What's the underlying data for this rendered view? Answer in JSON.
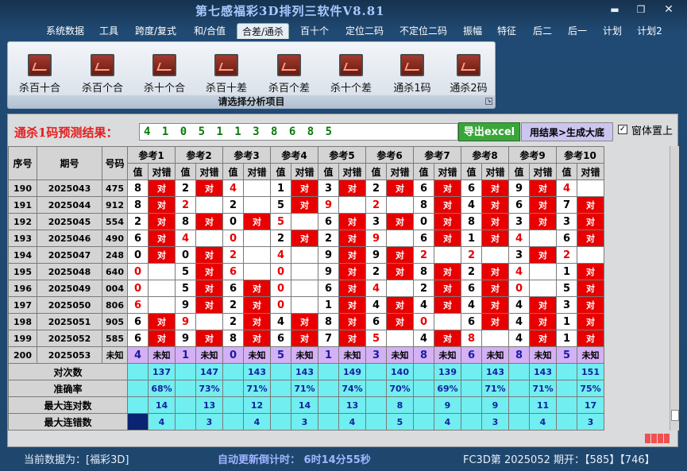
{
  "window": {
    "title": "第七感福彩3D排列三软件V8.81"
  },
  "menu": [
    "系统数据",
    "工具",
    "跨度/复式",
    "和/合值",
    "合差/通杀",
    "百十个",
    "定位二码",
    "不定位二码",
    "振幅",
    "特征",
    "后二",
    "后一",
    "计划",
    "计划2"
  ],
  "ribbon": {
    "buttons": [
      "杀百十合",
      "杀百个合",
      "杀十个合",
      "杀百十差",
      "杀百个差",
      "杀十个差",
      "通杀1码",
      "通杀2码"
    ],
    "caption": "请选择分析项目"
  },
  "prediction": {
    "label": "通杀1码预测结果：",
    "value": "4 1 0 5 1 1 3 8 6 8 5"
  },
  "buttons": {
    "export": "导出excel",
    "generate": "用结果>生成大底",
    "topmost": "窗体置上"
  },
  "table": {
    "headers": {
      "seq": "序号",
      "period": "期号",
      "code": "号码",
      "refs": [
        "参考1",
        "参考2",
        "参考3",
        "参考4",
        "参考5",
        "参考6",
        "参考7",
        "参考8",
        "参考9",
        "参考10"
      ],
      "val": "值",
      "ok": "对错"
    },
    "rows": [
      {
        "seq": "190",
        "period": "2025043",
        "code": "475",
        "cells": [
          [
            "8",
            1,
            0
          ],
          [
            "2",
            1,
            0
          ],
          [
            "4",
            0,
            1
          ],
          [
            "1",
            1,
            0
          ],
          [
            "3",
            1,
            0
          ],
          [
            "2",
            1,
            0
          ],
          [
            "6",
            1,
            0
          ],
          [
            "6",
            1,
            0
          ],
          [
            "9",
            1,
            0
          ],
          [
            "4",
            0,
            1
          ]
        ]
      },
      {
        "seq": "191",
        "period": "2025044",
        "code": "912",
        "cells": [
          [
            "8",
            1,
            0
          ],
          [
            "2",
            0,
            1
          ],
          [
            "2",
            0,
            0
          ],
          [
            "5",
            1,
            0
          ],
          [
            "9",
            0,
            1
          ],
          [
            "2",
            0,
            1
          ],
          [
            "8",
            1,
            0
          ],
          [
            "4",
            1,
            0
          ],
          [
            "6",
            1,
            0
          ],
          [
            "7",
            1,
            0
          ]
        ]
      },
      {
        "seq": "192",
        "period": "2025045",
        "code": "554",
        "cells": [
          [
            "2",
            1,
            0
          ],
          [
            "8",
            1,
            0
          ],
          [
            "0",
            1,
            0
          ],
          [
            "5",
            0,
            1
          ],
          [
            "6",
            1,
            0
          ],
          [
            "3",
            1,
            0
          ],
          [
            "0",
            1,
            0
          ],
          [
            "8",
            1,
            0
          ],
          [
            "3",
            1,
            0
          ],
          [
            "3",
            1,
            0
          ]
        ]
      },
      {
        "seq": "193",
        "period": "2025046",
        "code": "490",
        "cells": [
          [
            "6",
            1,
            0
          ],
          [
            "4",
            0,
            1
          ],
          [
            "0",
            0,
            1
          ],
          [
            "2",
            1,
            0
          ],
          [
            "2",
            1,
            0
          ],
          [
            "9",
            0,
            1
          ],
          [
            "6",
            1,
            0
          ],
          [
            "1",
            1,
            0
          ],
          [
            "4",
            0,
            1
          ],
          [
            "6",
            1,
            0
          ]
        ]
      },
      {
        "seq": "194",
        "period": "2025047",
        "code": "248",
        "cells": [
          [
            "0",
            1,
            0
          ],
          [
            "0",
            1,
            0
          ],
          [
            "2",
            0,
            1
          ],
          [
            "4",
            0,
            1
          ],
          [
            "9",
            1,
            0
          ],
          [
            "9",
            1,
            0
          ],
          [
            "2",
            0,
            1
          ],
          [
            "2",
            0,
            1
          ],
          [
            "3",
            1,
            0
          ],
          [
            "2",
            0,
            1
          ]
        ]
      },
      {
        "seq": "195",
        "period": "2025048",
        "code": "640",
        "cells": [
          [
            "0",
            0,
            1
          ],
          [
            "5",
            1,
            0
          ],
          [
            "6",
            0,
            1
          ],
          [
            "0",
            0,
            1
          ],
          [
            "9",
            1,
            0
          ],
          [
            "2",
            1,
            0
          ],
          [
            "8",
            1,
            0
          ],
          [
            "2",
            1,
            0
          ],
          [
            "4",
            0,
            1
          ],
          [
            "1",
            1,
            0
          ]
        ]
      },
      {
        "seq": "196",
        "period": "2025049",
        "code": "004",
        "cells": [
          [
            "0",
            0,
            1
          ],
          [
            "5",
            1,
            0
          ],
          [
            "6",
            1,
            0
          ],
          [
            "0",
            0,
            1
          ],
          [
            "6",
            1,
            0
          ],
          [
            "4",
            0,
            1
          ],
          [
            "2",
            1,
            0
          ],
          [
            "6",
            1,
            0
          ],
          [
            "0",
            0,
            1
          ],
          [
            "5",
            1,
            0
          ]
        ]
      },
      {
        "seq": "197",
        "period": "2025050",
        "code": "806",
        "cells": [
          [
            "6",
            0,
            1
          ],
          [
            "9",
            1,
            0
          ],
          [
            "2",
            1,
            0
          ],
          [
            "0",
            0,
            1
          ],
          [
            "1",
            1,
            0
          ],
          [
            "4",
            1,
            0
          ],
          [
            "4",
            1,
            0
          ],
          [
            "4",
            1,
            0
          ],
          [
            "4",
            1,
            0
          ],
          [
            "3",
            1,
            0
          ]
        ]
      },
      {
        "seq": "198",
        "period": "2025051",
        "code": "905",
        "cells": [
          [
            "6",
            1,
            0
          ],
          [
            "9",
            0,
            1
          ],
          [
            "2",
            1,
            0
          ],
          [
            "4",
            1,
            0
          ],
          [
            "8",
            1,
            0
          ],
          [
            "6",
            1,
            0
          ],
          [
            "0",
            0,
            1
          ],
          [
            "6",
            1,
            0
          ],
          [
            "4",
            1,
            0
          ],
          [
            "1",
            1,
            0
          ]
        ]
      },
      {
        "seq": "199",
        "period": "2025052",
        "code": "585",
        "cells": [
          [
            "6",
            1,
            0
          ],
          [
            "9",
            1,
            0
          ],
          [
            "8",
            1,
            0
          ],
          [
            "6",
            1,
            0
          ],
          [
            "7",
            1,
            0
          ],
          [
            "5",
            0,
            1
          ],
          [
            "4",
            1,
            0
          ],
          [
            "8",
            0,
            1
          ],
          [
            "4",
            1,
            0
          ],
          [
            "1",
            1,
            0
          ]
        ]
      }
    ],
    "pending": {
      "seq": "200",
      "period": "2025053",
      "code": "未知",
      "vals": [
        "4",
        "1",
        "0",
        "5",
        "1",
        "3",
        "8",
        "6",
        "8",
        "5"
      ],
      "unknown": "未知"
    },
    "stats": [
      {
        "label": "对次数",
        "vals": [
          "137",
          "147",
          "143",
          "143",
          "149",
          "140",
          "139",
          "143",
          "143",
          "151"
        ]
      },
      {
        "label": "准确率",
        "vals": [
          "68%",
          "73%",
          "71%",
          "71%",
          "74%",
          "70%",
          "69%",
          "71%",
          "71%",
          "75%"
        ]
      },
      {
        "label": "最大连对数",
        "vals": [
          "14",
          "13",
          "12",
          "14",
          "13",
          "8",
          "9",
          "9",
          "11",
          "17"
        ]
      },
      {
        "label": "最大连错数",
        "vals": [
          "4",
          "3",
          "4",
          "3",
          "4",
          "5",
          "4",
          "3",
          "4",
          "3"
        ]
      }
    ],
    "ok_mark": "对"
  },
  "status": {
    "current": "当前数据为：[福彩3D]",
    "countdown": "自动更新倒计时：  6时14分55秒",
    "latest": "FC3D第 2025052 期开：【585】【746】"
  },
  "colors": {
    "accent_red": "#e80000",
    "cyan": "#71eef0",
    "navy": "#0a2472",
    "green": "#3aa63a"
  }
}
